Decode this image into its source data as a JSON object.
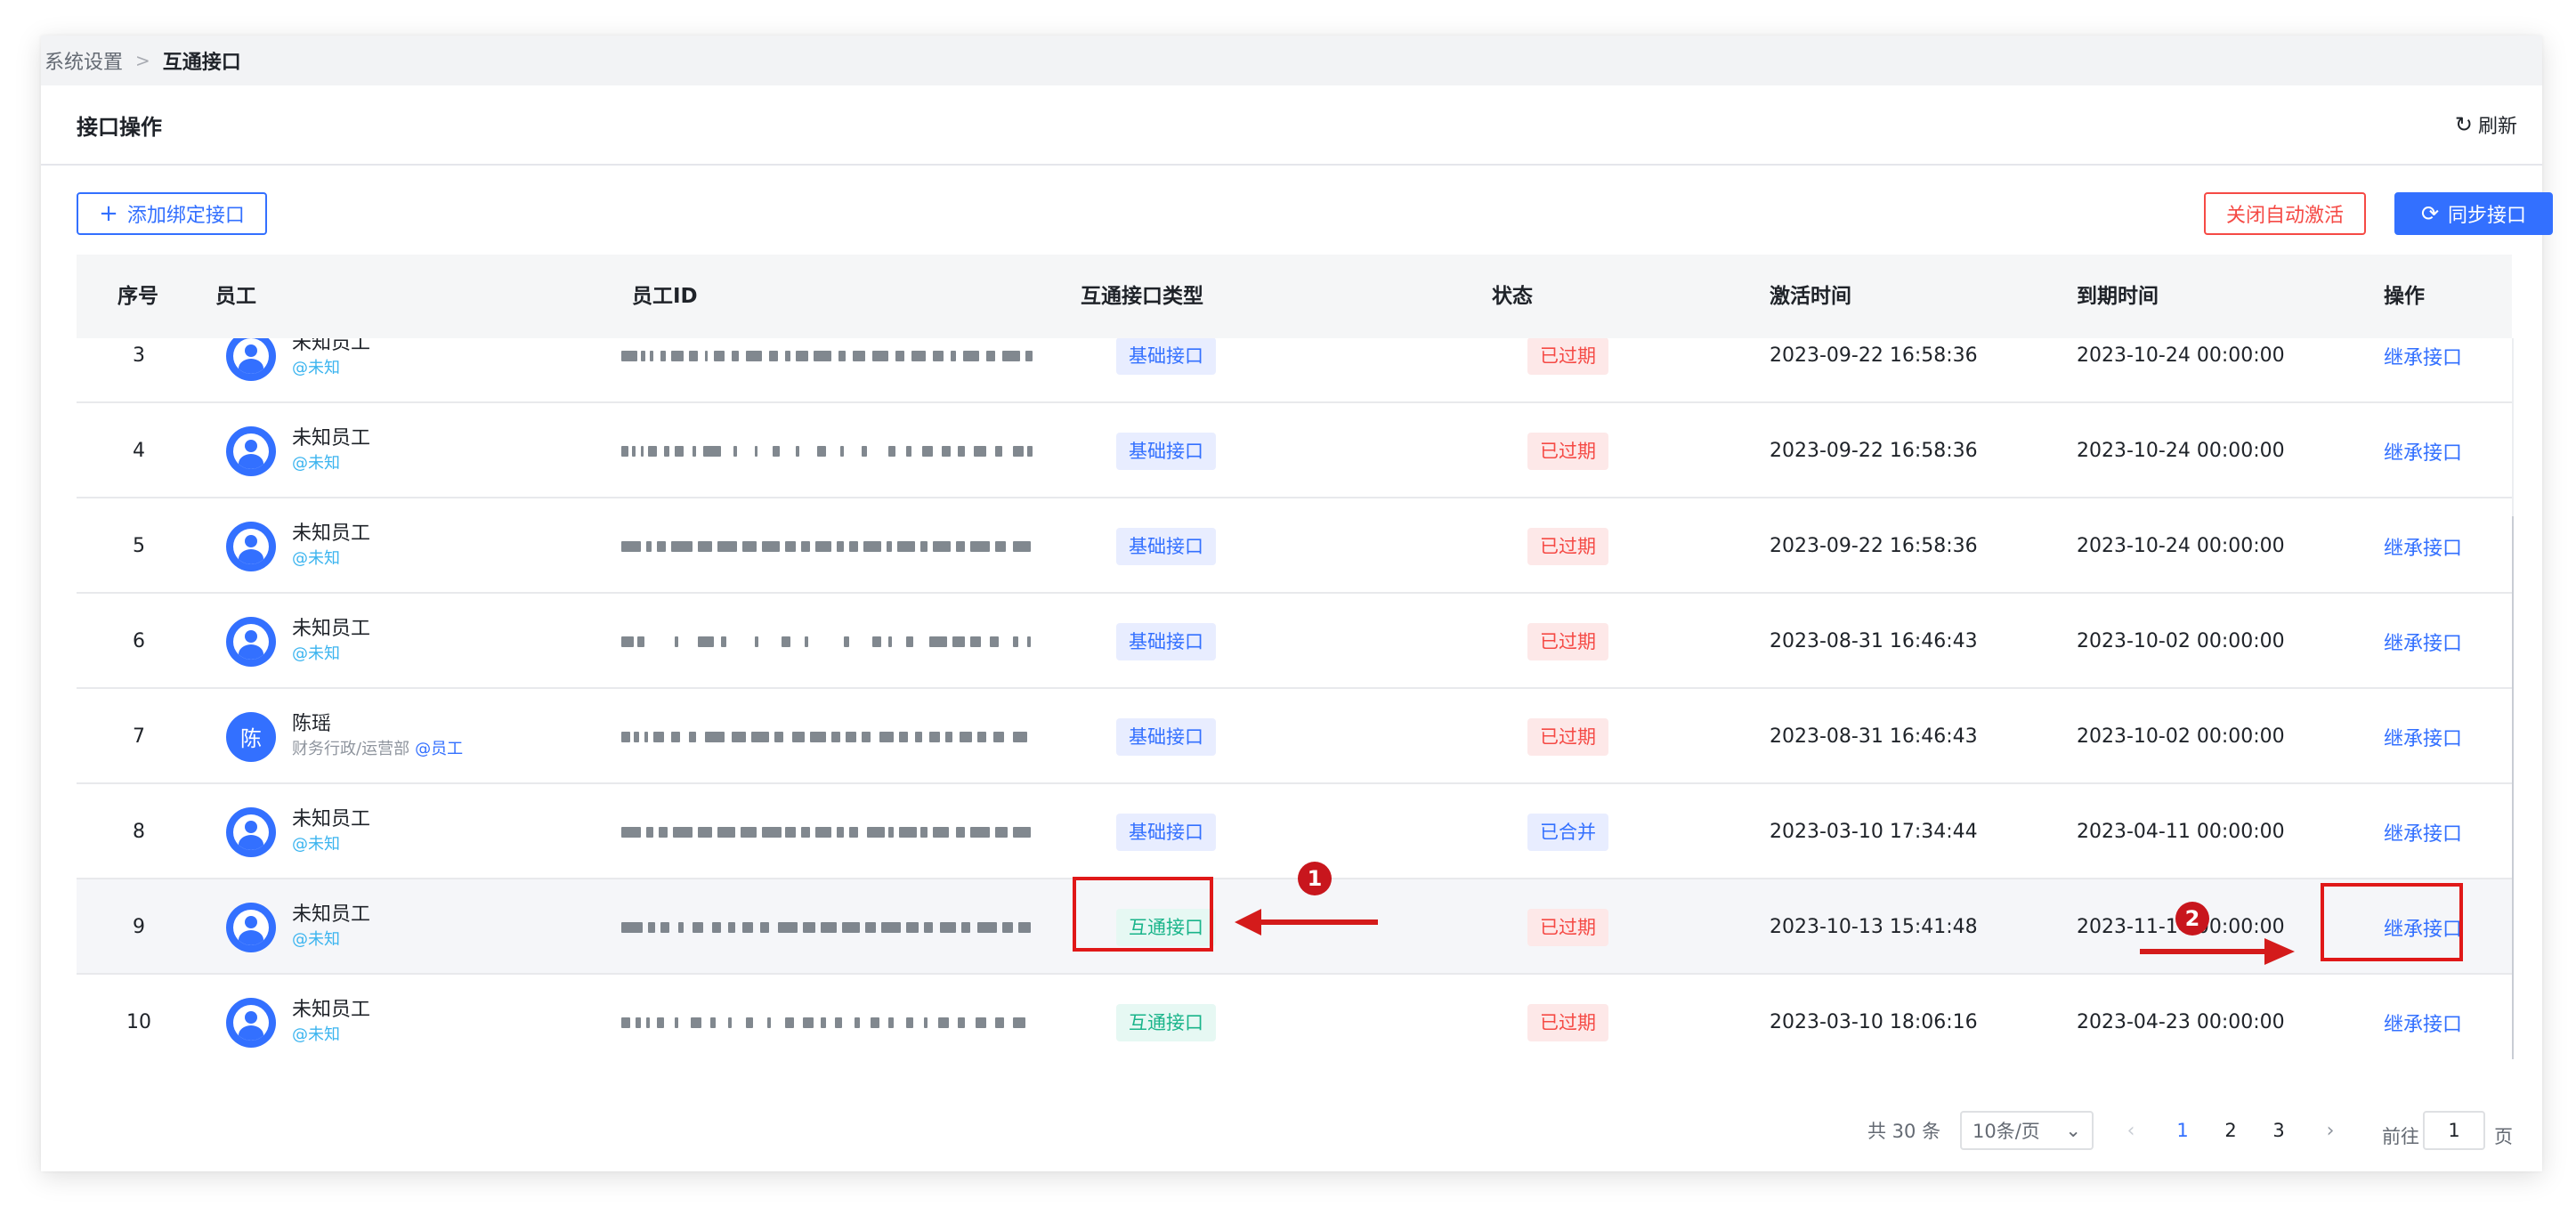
{
  "breadcrumb": {
    "parent": "系统设置",
    "separator": ">",
    "current": "互通接口"
  },
  "header": {
    "title": "接口操作",
    "refresh_label": "刷新",
    "refresh_icon": "refresh-icon"
  },
  "toolbar": {
    "add_label": "添加绑定接口",
    "close_label": "关闭自动激活",
    "sync_label": "同步接口",
    "plus_icon": "plus-icon",
    "sync_icon": "sync-icon"
  },
  "table": {
    "columns": [
      "序号",
      "员工",
      "员工ID",
      "互通接口类型",
      "状态",
      "激活时间",
      "到期时间",
      "操作"
    ],
    "rows": [
      {
        "idx": "3",
        "name": "未知员工",
        "dept": "",
        "tag": "@未知",
        "type": "基础接口",
        "type_kind": "basic",
        "status": "已过期",
        "status_kind": "expired",
        "activate": "2023-09-22 16:58:36",
        "expire": "2023-10-24 00:00:00",
        "op": "继承接口"
      },
      {
        "idx": "4",
        "name": "未知员工",
        "dept": "",
        "tag": "@未知",
        "type": "基础接口",
        "type_kind": "basic",
        "status": "已过期",
        "status_kind": "expired",
        "activate": "2023-09-22 16:58:36",
        "expire": "2023-10-24 00:00:00",
        "op": "继承接口"
      },
      {
        "idx": "5",
        "name": "未知员工",
        "dept": "",
        "tag": "@未知",
        "type": "基础接口",
        "type_kind": "basic",
        "status": "已过期",
        "status_kind": "expired",
        "activate": "2023-09-22 16:58:36",
        "expire": "2023-10-24 00:00:00",
        "op": "继承接口"
      },
      {
        "idx": "6",
        "name": "未知员工",
        "dept": "",
        "tag": "@未知",
        "type": "基础接口",
        "type_kind": "basic",
        "status": "已过期",
        "status_kind": "expired",
        "activate": "2023-08-31 16:46:43",
        "expire": "2023-10-02 00:00:00",
        "op": "继承接口"
      },
      {
        "idx": "7",
        "name": "陈瑶",
        "avatar_text": "陈",
        "dept": "财务行政/运营部",
        "tag": "@员工",
        "type": "基础接口",
        "type_kind": "basic",
        "status": "已过期",
        "status_kind": "expired",
        "activate": "2023-08-31 16:46:43",
        "expire": "2023-10-02 00:00:00",
        "op": "继承接口"
      },
      {
        "idx": "8",
        "name": "未知员工",
        "dept": "",
        "tag": "@未知",
        "type": "基础接口",
        "type_kind": "basic",
        "status": "已合并",
        "status_kind": "merged",
        "activate": "2023-03-10 17:34:44",
        "expire": "2023-04-11 00:00:00",
        "op": "继承接口"
      },
      {
        "idx": "9",
        "name": "未知员工",
        "dept": "",
        "tag": "@未知",
        "type": "互通接口",
        "type_kind": "mutual",
        "status": "已过期",
        "status_kind": "expired",
        "activate": "2023-10-13 15:41:48",
        "expire": "2023-11-14 00:00:00",
        "op": "继承接口"
      },
      {
        "idx": "10",
        "name": "未知员工",
        "dept": "",
        "tag": "@未知",
        "type": "互通接口",
        "type_kind": "mutual",
        "status": "已过期",
        "status_kind": "expired",
        "activate": "2023-03-10 18:06:16",
        "expire": "2023-04-23 00:00:00",
        "op": "继承接口"
      }
    ]
  },
  "pagination": {
    "total": "共 30 条",
    "page_size": "10条/页",
    "pages": [
      "1",
      "2",
      "3"
    ],
    "current": "1",
    "goto_label": "前往",
    "goto_value": "1",
    "page_suffix": "页"
  },
  "annotations": {
    "badge_1": "1",
    "badge_2": "2"
  },
  "colors": {
    "primary": "#3370ff",
    "danger": "#f54a45",
    "success": "#19b48a",
    "annotation": "#e01818"
  }
}
